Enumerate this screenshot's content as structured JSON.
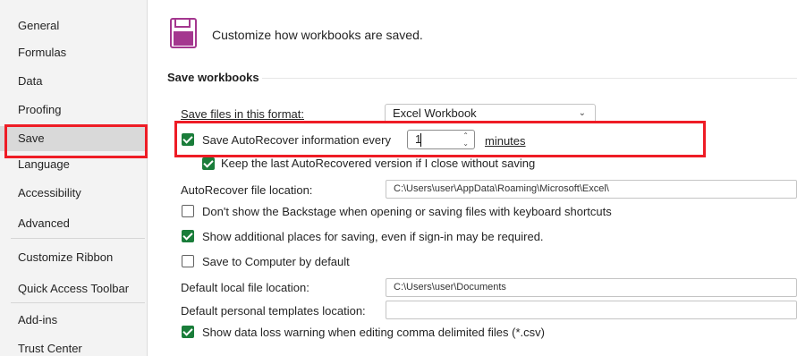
{
  "sidebar": {
    "items": [
      {
        "label": "General"
      },
      {
        "label": "Formulas"
      },
      {
        "label": "Data"
      },
      {
        "label": "Proofing"
      },
      {
        "label": "Save",
        "selected": true
      },
      {
        "label": "Language"
      },
      {
        "label": "Accessibility"
      },
      {
        "label": "Advanced"
      },
      {
        "label": "Customize Ribbon"
      },
      {
        "label": "Quick Access Toolbar"
      },
      {
        "label": "Add-ins"
      },
      {
        "label": "Trust Center"
      }
    ]
  },
  "header": {
    "icon": "save-floppy-icon",
    "text": "Customize how workbooks are saved."
  },
  "save_workbooks": {
    "title": "Save workbooks",
    "format_label": "Save files in this format:",
    "format_value": "Excel Workbook",
    "autorecover_label": "Save AutoRecover information every",
    "autorecover_checked": true,
    "autorecover_minutes": "1",
    "minutes_label": "minutes",
    "keep_last_label": "Keep the last AutoRecovered version if I close without saving",
    "keep_last_checked": true,
    "autorecover_location_label": "AutoRecover file location:",
    "autorecover_location_value": "C:\\Users\\user\\AppData\\Roaming\\Microsoft\\Excel\\",
    "backstage_label": "Don't show the Backstage when opening or saving files with keyboard shortcuts",
    "backstage_checked": false,
    "additional_places_label": "Show additional places for saving, even if sign-in may be required.",
    "additional_places_checked": true,
    "save_to_computer_label": "Save to Computer by default",
    "save_to_computer_checked": false,
    "default_local_label": "Default local file location:",
    "default_local_value": "C:\\Users\\user\\Documents",
    "default_templates_label": "Default personal templates location:",
    "default_templates_value": "",
    "data_loss_label": "Show data loss warning when editing comma delimited files (*.csv)",
    "data_loss_checked": true
  },
  "colors": {
    "highlight": "#ee1c25",
    "checkbox_checked": "#1a7d3a",
    "save_icon": "#a4378f"
  }
}
